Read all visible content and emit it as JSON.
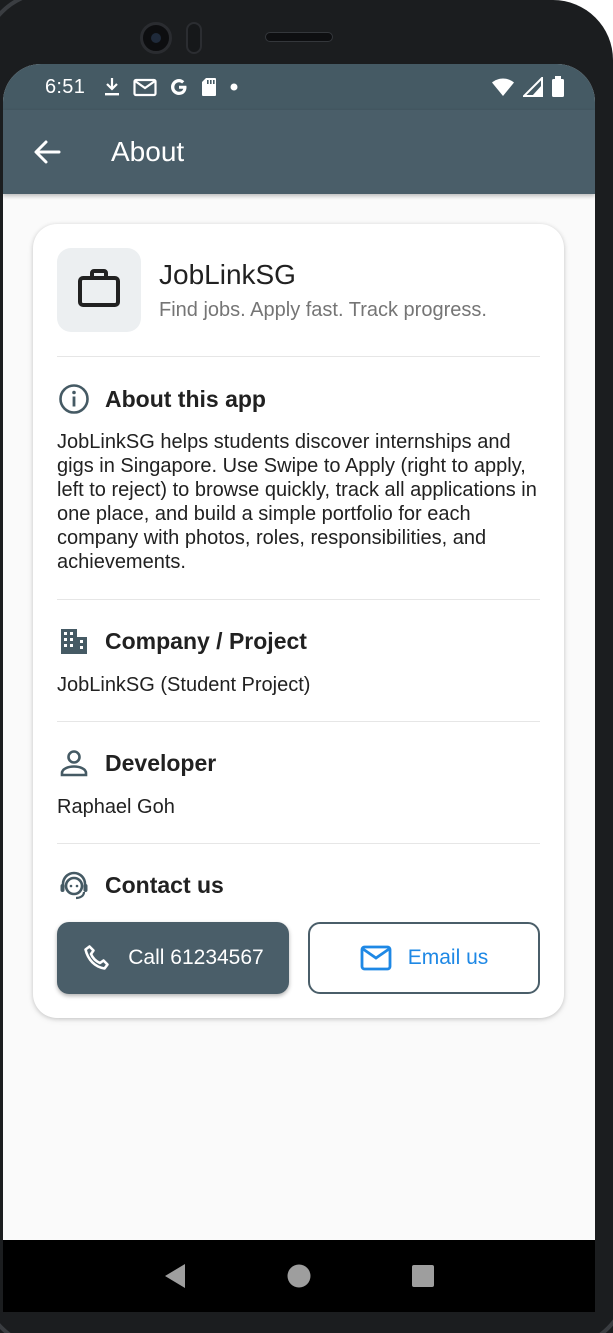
{
  "status_bar": {
    "time": "6:51",
    "left_icons": [
      "download-icon",
      "mail-icon",
      "google-icon",
      "sd-card-icon",
      "dot-icon"
    ],
    "right_icons": [
      "wifi-icon",
      "signal-icon",
      "battery-icon"
    ]
  },
  "app_bar": {
    "title": "About",
    "back_icon": "arrow-back-icon"
  },
  "app_info": {
    "name": "JobLinkSG",
    "tagline": "Find jobs. Apply fast. Track progress.",
    "icon": "briefcase-icon"
  },
  "about": {
    "title": "About this app",
    "text": "JobLinkSG helps students discover internships and gigs in Singapore. Use Swipe to Apply (right to apply, left to reject) to browse quickly, track all applications in one place, and build a simple portfolio for each company with photos, roles, responsibilities, and achievements."
  },
  "company": {
    "title": "Company / Project",
    "text": "JobLinkSG (Student Project)"
  },
  "developer": {
    "title": "Developer",
    "text": "Raphael Goh"
  },
  "contact": {
    "title": "Contact us",
    "call_label": "Call 61234567",
    "email_label": "Email us"
  },
  "colors": {
    "primary": "#455a64",
    "accent": "#1e88e5",
    "background": "#fafafa"
  }
}
